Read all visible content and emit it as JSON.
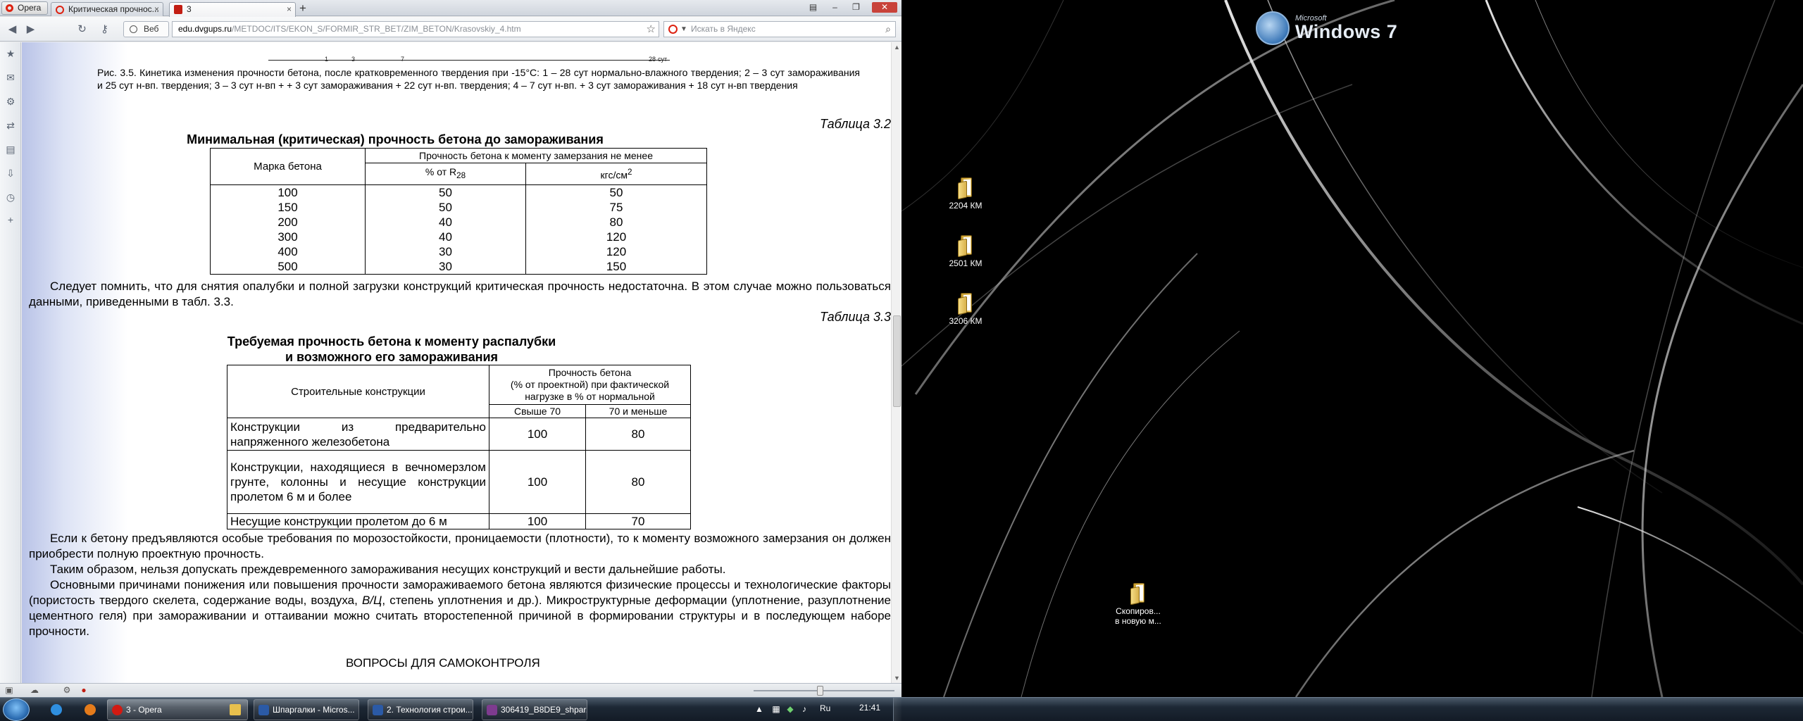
{
  "browser": {
    "menu_label": "Opera",
    "tabs": [
      {
        "label": "Критическая прочнос..."
      },
      {
        "label": "3"
      }
    ],
    "new_tab": "+",
    "nav": {
      "web_label": "Веб",
      "url_host": "edu.dvgups.ru",
      "url_path": "/METDOC/ITS/EKON_S/FORMIR_STR_BET/ZIM_BETON/Krasovskiy_4.htm",
      "search_placeholder": "Искать в Яндекс"
    }
  },
  "document": {
    "figure_ticks": [
      "1",
      "3",
      "7",
      "28"
    ],
    "figure_tick_unit": "сут",
    "caption": "Рис. 3.5. Кинетика изменения прочности бетона, после кратковременного твердения при -15°С: 1 – 28 сут нормально-влажного твердения; 2 – 3 сут замораживания и 25 сут н-вп. твердения; 3 – 3 сут н-вп + + 3 сут замораживания + 22 сут н-вп. твердения; 4 – 7 сут н-вп. + 3 сут замораживания + 18 сут н-вп твердения",
    "table32": {
      "label": "Таблица 3.2",
      "title": "Минимальная (критическая) прочность бетона до замораживания",
      "col_mark": "Марка бетона",
      "col_strength": "Прочность бетона к моменту замерзания не менее",
      "col_percent": "% от R",
      "col_percent_sub": "28",
      "col_kgs": "кгс/см",
      "col_kgs_sup": "2",
      "rows": [
        [
          "100",
          "50",
          "50"
        ],
        [
          "150",
          "50",
          "75"
        ],
        [
          "200",
          "40",
          "80"
        ],
        [
          "300",
          "40",
          "120"
        ],
        [
          "400",
          "30",
          "120"
        ],
        [
          "500",
          "30",
          "150"
        ]
      ]
    },
    "para1": "Следует помнить, что для снятия опалубки и полной загрузки конструкций критическая прочность недостаточна. В этом случае можно пользоваться данными, приведенными в табл. 3.3.",
    "table33": {
      "label": "Таблица 3.3",
      "title_line1": "Требуемая прочность бетона к моменту распалубки",
      "title_line2": "и возможного его замораживания",
      "col_struct": "Строительные конструкции",
      "col_strength_l1": "Прочность бетона",
      "col_strength_l2": "(% от проектной) при фактической",
      "col_strength_l3": "нагрузке в  % от нормальной",
      "col_over70": "Свыше 70",
      "col_le70": "70 и меньше",
      "rows": [
        {
          "label": "Конструкции из предварительно напряженного железобетона",
          "a": "100",
          "b": "80"
        },
        {
          "label": "Конструкции, находящиеся в вечномерзлом грунте, колонны и несущие конструкции пролетом 6 м и более",
          "a": "100",
          "b": "80"
        },
        {
          "label": "Несущие конструкции пролетом до 6 м",
          "a": "100",
          "b": "70"
        }
      ]
    },
    "para2": "Если к бетону предъявляются особые требования по морозостойкости, проницаемости (плотности), то к моменту возможного замерзания он должен приобрести полную проектную прочность.",
    "para3": "Таким образом, нельзя допускать преждевременного замораживания несущих конструкций и вести дальнейшие работы.",
    "para4_a": "Основными причинами понижения или повышения прочности замораживаемого бетона являются физические процессы и технологические факторы (пористость твердого скелета, содержание воды, воздуха, ",
    "para4_em": "В/Ц",
    "para4_b": ", степень уплотнения и др.). Микроструктурные деформации (уплотнение, разуплотнение цементного геля) при замораживании и оттаивании можно считать второстепенной причиной в формировании структуры и в последующем наборе прочности.",
    "questions_heading": "ВОПРОСЫ ДЛЯ САМОКОНТРОЛЯ"
  },
  "desktop": {
    "brand_small": "Microsoft",
    "brand_big": "Windows 7",
    "icons": [
      {
        "label": "2204 КМ"
      },
      {
        "label": "2501 КМ"
      },
      {
        "label": "3206 КМ"
      },
      {
        "label_l1": "Скопиров...",
        "label_l2": "в новую м..."
      }
    ]
  },
  "taskbar": {
    "buttons": [
      {
        "label": "3 - Opera"
      },
      {
        "label": "Шпаргалки - Micros..."
      },
      {
        "label": "2. Технология строи..."
      },
      {
        "label": "306419_B8DE9_shpar..."
      }
    ],
    "lang": "Ru",
    "clock": "21:41"
  },
  "colors": {
    "opera_red": "#d21a12",
    "page_gradient_left": "#b9c3e7",
    "taskbar_dark": "#1d2835"
  }
}
